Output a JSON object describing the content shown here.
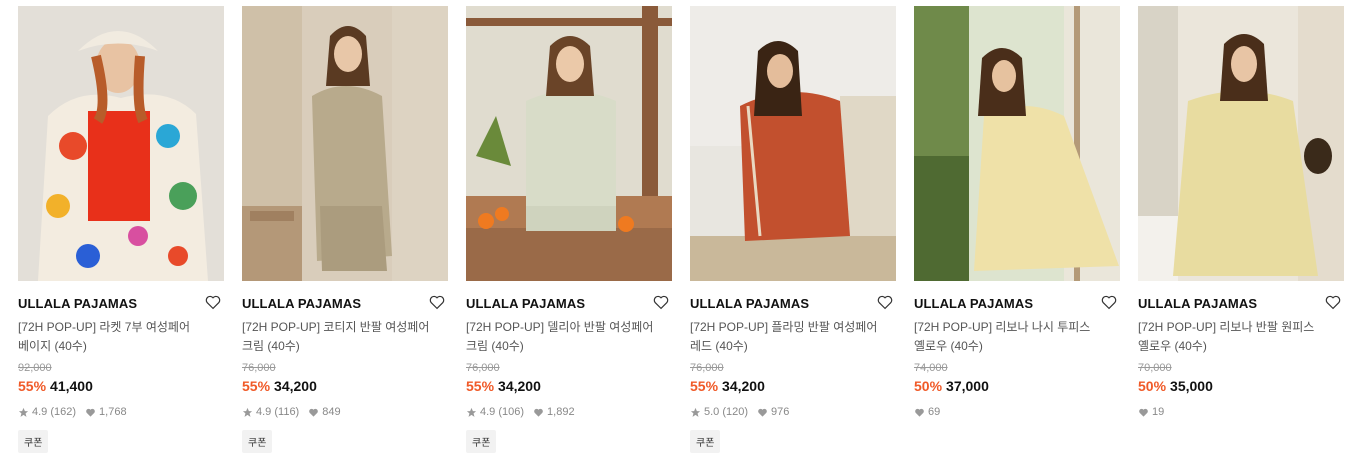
{
  "products": [
    {
      "brand": "ULLALA PAJAMAS",
      "title_line1": "[72H POP-UP] 라켓 7부 여성페어",
      "title_line2": "베이지 (40수)",
      "original_price": "92,000",
      "discount": "55%",
      "price": "41,400",
      "rating": "4.9",
      "reviews": "(162)",
      "likes": "1,768",
      "coupon": "쿠폰"
    },
    {
      "brand": "ULLALA PAJAMAS",
      "title_line1": "[72H POP-UP] 코티지 반팔 여성페어",
      "title_line2": "크림 (40수)",
      "original_price": "76,000",
      "discount": "55%",
      "price": "34,200",
      "rating": "4.9",
      "reviews": "(116)",
      "likes": "849",
      "coupon": "쿠폰"
    },
    {
      "brand": "ULLALA PAJAMAS",
      "title_line1": "[72H POP-UP] 델리아 반팔 여성페어",
      "title_line2": "크림 (40수)",
      "original_price": "76,000",
      "discount": "55%",
      "price": "34,200",
      "rating": "4.9",
      "reviews": "(106)",
      "likes": "1,892",
      "coupon": "쿠폰"
    },
    {
      "brand": "ULLALA PAJAMAS",
      "title_line1": "[72H POP-UP] 플라밍 반팔 여성페어",
      "title_line2": "레드 (40수)",
      "original_price": "76,000",
      "discount": "55%",
      "price": "34,200",
      "rating": "5.0",
      "reviews": "(120)",
      "likes": "976",
      "coupon": "쿠폰"
    },
    {
      "brand": "ULLALA PAJAMAS",
      "title_line1": "[72H POP-UP] 리보나 나시 투피스",
      "title_line2": "옐로우 (40수)",
      "original_price": "74,000",
      "discount": "50%",
      "price": "37,000",
      "likes": "69"
    },
    {
      "brand": "ULLALA PAJAMAS",
      "title_line1": "[72H POP-UP] 리보나 반팔 원피스",
      "title_line2": "옐로우 (40수)",
      "original_price": "70,000",
      "discount": "50%",
      "price": "35,000",
      "likes": "19"
    }
  ],
  "icons": {
    "wishlist": "heart-outline-icon",
    "rating": "star-icon",
    "likes": "heart-filled-icon"
  },
  "colors": {
    "discount": "#f05a28",
    "meta": "#888888",
    "coupon_bg": "#f2f2f2"
  }
}
